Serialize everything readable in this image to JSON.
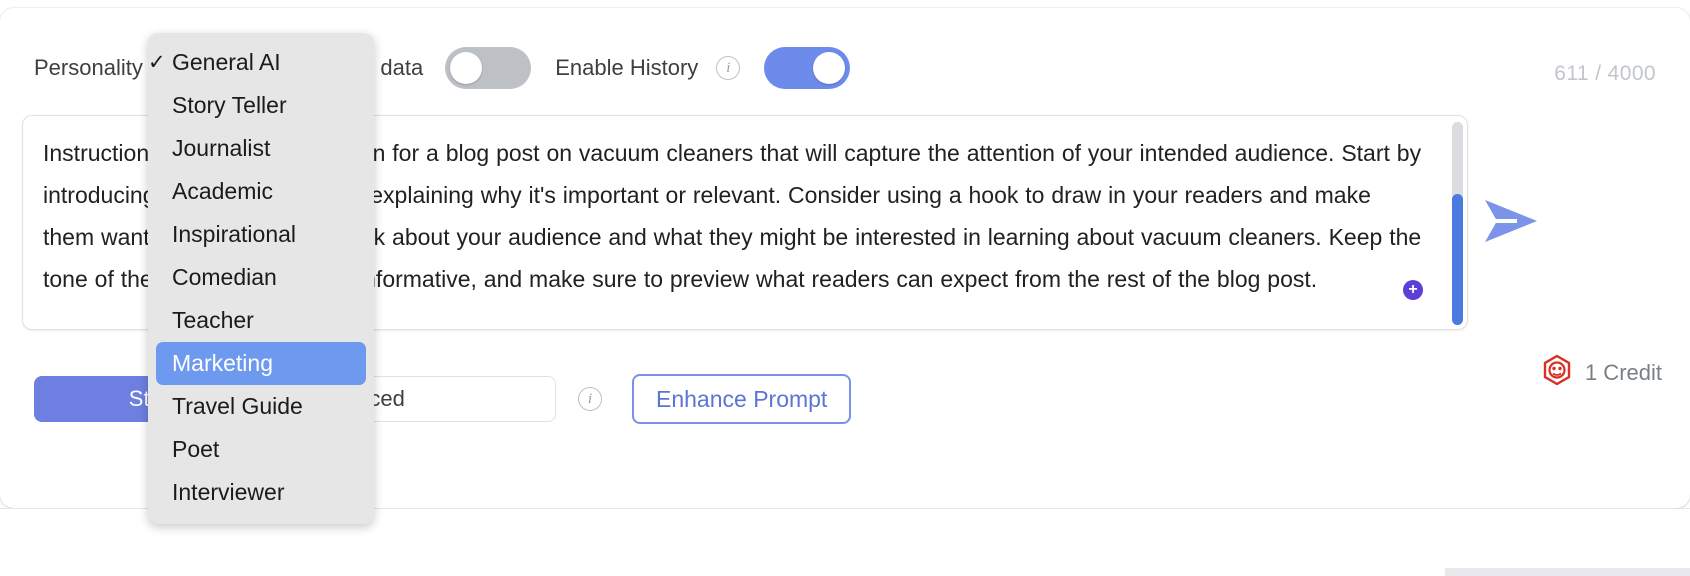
{
  "toolbar": {
    "personality_label": "Personality",
    "search_label": "Search latest Google data",
    "search_toggle_state": "off",
    "history_label": "Enable History",
    "history_toggle_state": "on",
    "info_icon": "info-icon",
    "char_counter": "611 / 4000"
  },
  "prompt": {
    "value": "Instructions: Write an introduction for a blog post on vacuum cleaners that will capture the attention of your intended audience. Start by introducing the topic and briefly explaining why it's important or relevant. Consider using a hook to draw in your readers and make them want to keep reading. Think about your audience and what they might be interested in learning about vacuum cleaners. Keep the tone of the intro engaging and informative, and make sure to preview what readers can expect from the rest of the blog post.",
    "send_icon": "send-arrow-icon",
    "cursor_badge": "+"
  },
  "actions": {
    "start_label": "Start",
    "advanced_label": "Advanced",
    "advanced_info_icon": "info-icon",
    "enhance_label": "Enhance Prompt"
  },
  "credit": {
    "icon": "bot-hexagon-icon",
    "label": "1 Credit",
    "color": "#d93025"
  },
  "dropdown": {
    "name": "personality-dropdown",
    "check_glyph": "✓",
    "items": [
      {
        "label": "General AI",
        "checked": true,
        "selected": false
      },
      {
        "label": "Story Teller",
        "checked": false,
        "selected": false
      },
      {
        "label": "Journalist",
        "checked": false,
        "selected": false
      },
      {
        "label": "Academic",
        "checked": false,
        "selected": false
      },
      {
        "label": "Inspirational",
        "checked": false,
        "selected": false
      },
      {
        "label": "Comedian",
        "checked": false,
        "selected": false
      },
      {
        "label": "Teacher",
        "checked": false,
        "selected": false
      },
      {
        "label": "Marketing",
        "checked": false,
        "selected": true
      },
      {
        "label": "Travel Guide",
        "checked": false,
        "selected": false
      },
      {
        "label": "Poet",
        "checked": false,
        "selected": false
      },
      {
        "label": "Interviewer",
        "checked": false,
        "selected": false
      }
    ]
  },
  "colors": {
    "accent_blue": "#6d7fe0",
    "toggle_on": "#6d8bea",
    "toggle_off": "#bdc1c6",
    "highlight": "#6d9aef",
    "credit_red": "#d93025"
  }
}
